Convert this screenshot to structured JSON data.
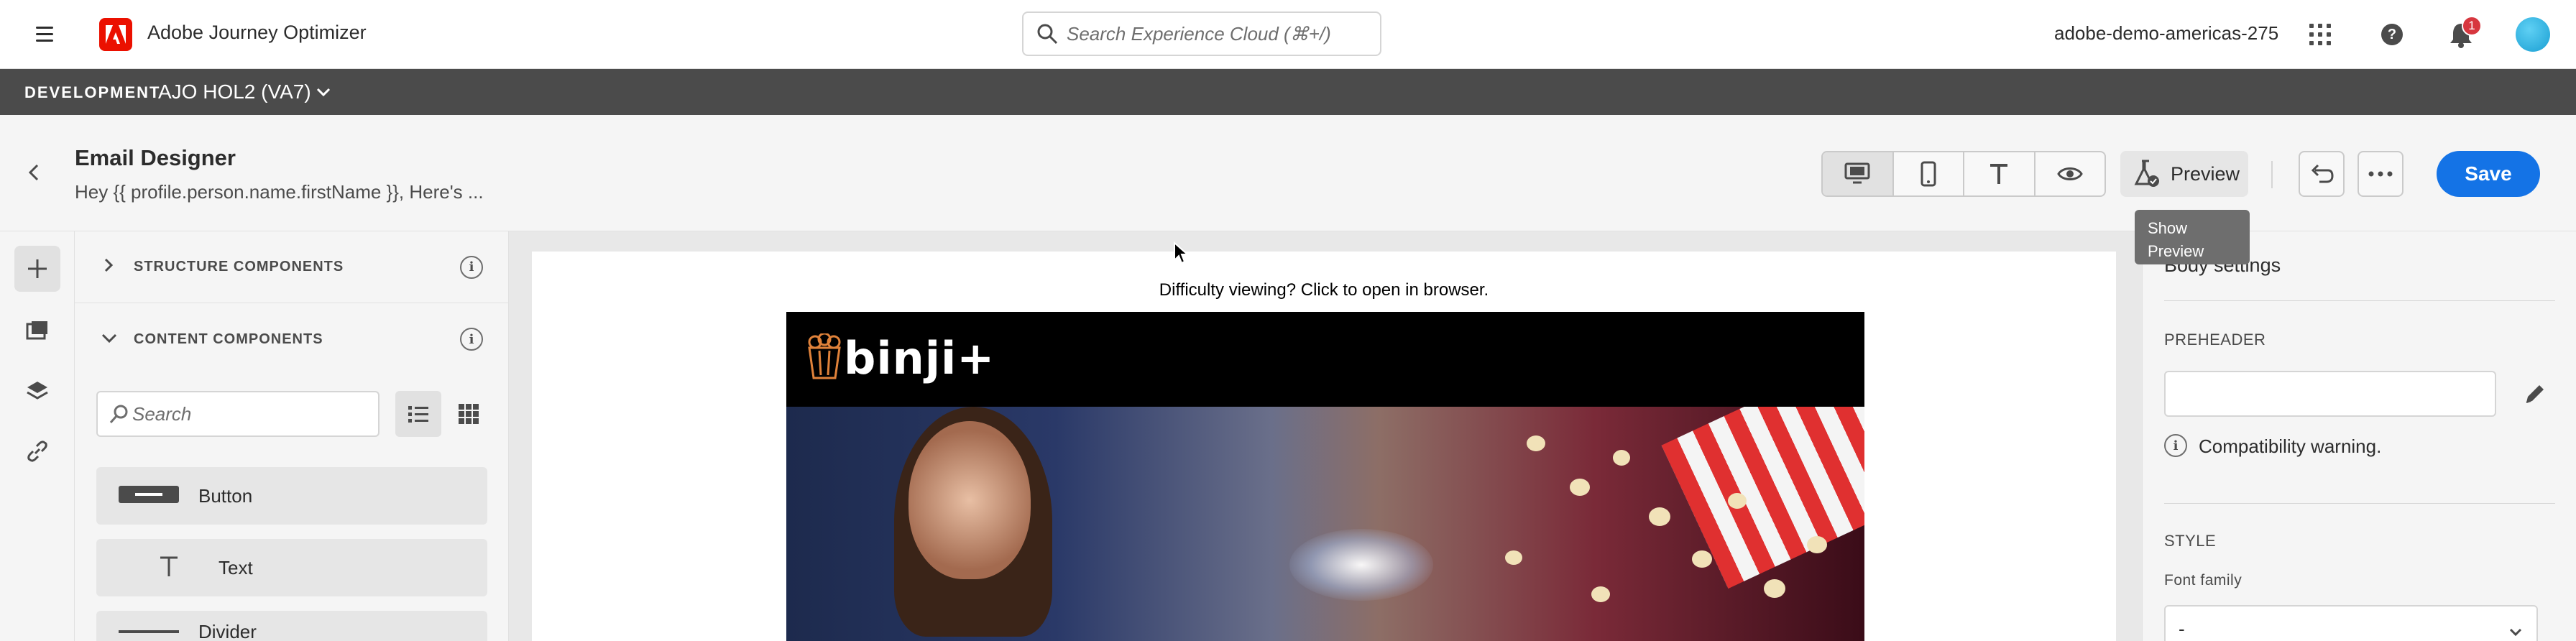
{
  "shell": {
    "app_name": "Adobe Journey Optimizer",
    "search_placeholder": "Search Experience Cloud (⌘+/)",
    "org_name": "adobe-demo-americas-275",
    "notification_count": "1"
  },
  "sandbox": {
    "environment": "DEVELOPMENT",
    "name": "AJO HOL2 (VA7)"
  },
  "header": {
    "title": "Email Designer",
    "subject": "Hey {{ profile.person.name.firstName }}, Here's ...",
    "preview_label": "Preview",
    "preview_tooltip_line1": "Show",
    "preview_tooltip_line2": "Preview",
    "save_label": "Save"
  },
  "components": {
    "structure_title": "STRUCTURE COMPONENTS",
    "content_title": "CONTENT COMPONENTS",
    "search_placeholder": "Search",
    "items": [
      {
        "label": "Button",
        "icon": "button-icon"
      },
      {
        "label": "Text",
        "icon": "text-icon"
      },
      {
        "label": "Divider",
        "icon": "divider-icon"
      }
    ]
  },
  "canvas": {
    "difficulty_text": "Difficulty viewing? Click to open in browser.",
    "brand": "binji+"
  },
  "properties": {
    "section_title": "Body settings",
    "preheader_label": "PREHEADER",
    "preheader_value": "",
    "compatibility_warning": "Compatibility warning.",
    "style_label": "STYLE",
    "font_family_label": "Font family",
    "font_family_value": "-"
  },
  "colors": {
    "accent": "#1473e6",
    "brand_red": "#eb1000",
    "sandbox_bar": "#4b4b4b",
    "badge": "#d7373f"
  }
}
